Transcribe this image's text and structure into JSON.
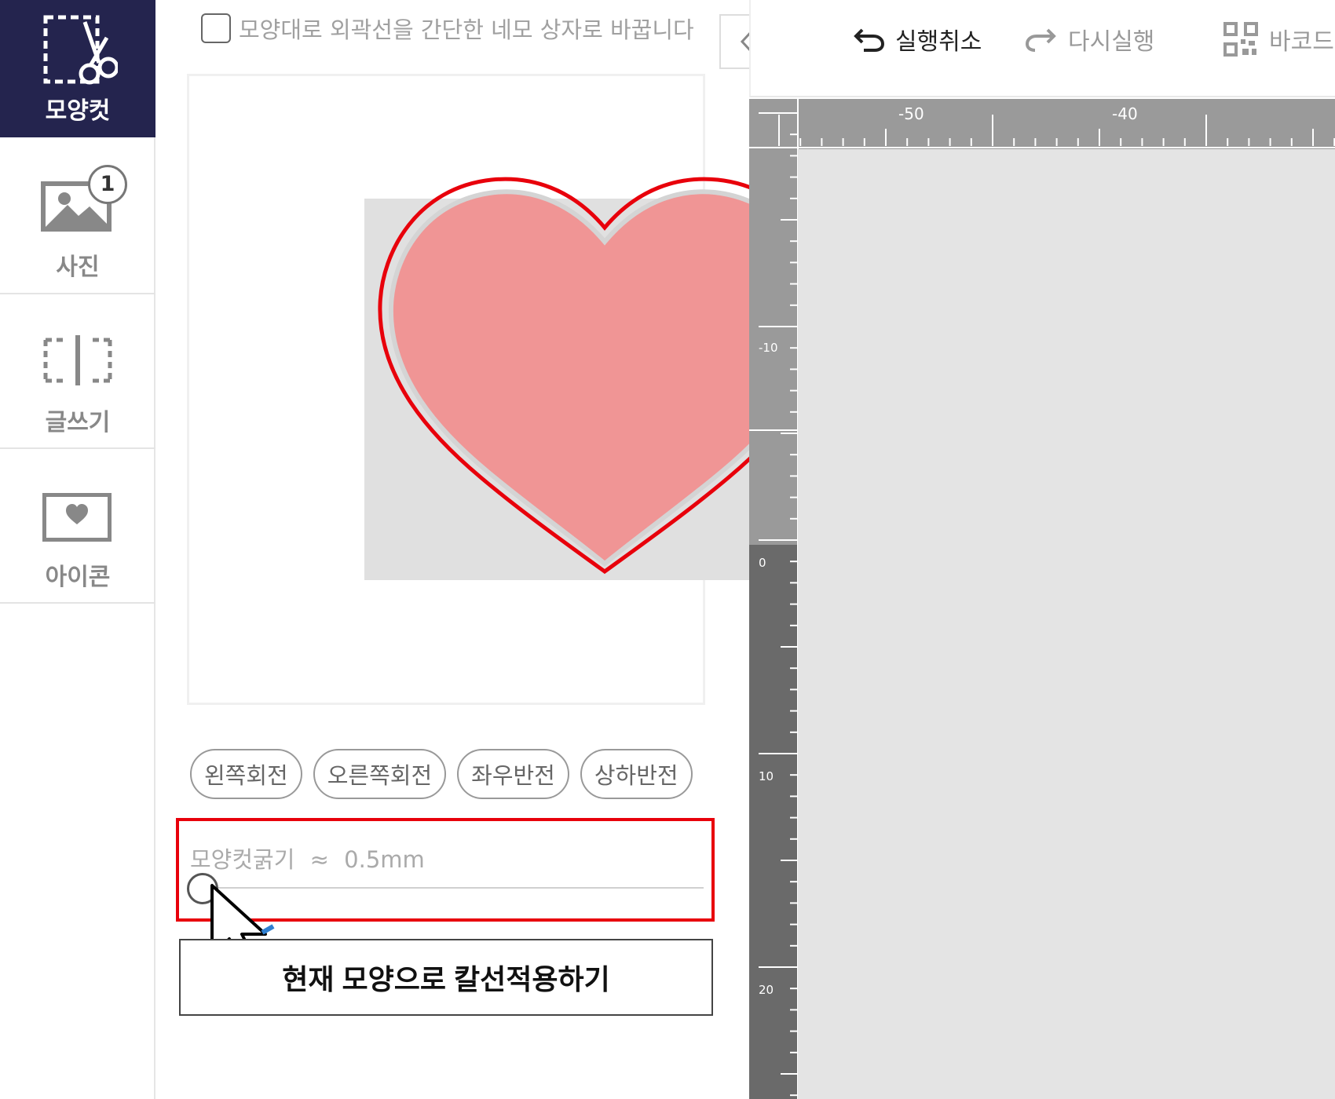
{
  "sidebar": {
    "items": [
      {
        "id": "shape-cut",
        "label": "모양컷",
        "icon": "scissors-dashed-icon",
        "active": true
      },
      {
        "id": "photo",
        "label": "사진",
        "icon": "photo-icon",
        "badge": "1"
      },
      {
        "id": "text",
        "label": "글쓰기",
        "icon": "text-cursor-icon"
      },
      {
        "id": "icon",
        "label": "아이콘",
        "icon": "heart-frame-icon"
      }
    ]
  },
  "panel": {
    "simplify_label": "모양대로 외곽선을 간단한 네모 상자로 바꿉니다",
    "simplify_checked": false,
    "buttons": {
      "rotate_left": "왼쪽회전",
      "rotate_right": "오른쪽회전",
      "flip_horizontal": "좌우반전",
      "flip_vertical": "상하반전"
    },
    "thickness": {
      "label": "모양컷굵기",
      "approx": "≈",
      "value": "0.5mm",
      "slider_position": 0
    },
    "apply_button": "현재 모양으로 칼선적용하기"
  },
  "toolbar": {
    "undo": "실행취소",
    "redo": "다시실행",
    "barcode": "바코드"
  },
  "ruler": {
    "top_labels": [
      "-50",
      "-40"
    ],
    "left_labels": [
      "-10",
      "0",
      "10",
      "20"
    ]
  },
  "colors": {
    "sidebar_active": "#24244e",
    "heart_fill": "#f09595",
    "cut_line": "#e8000b",
    "highlight_border": "#e8000b"
  }
}
